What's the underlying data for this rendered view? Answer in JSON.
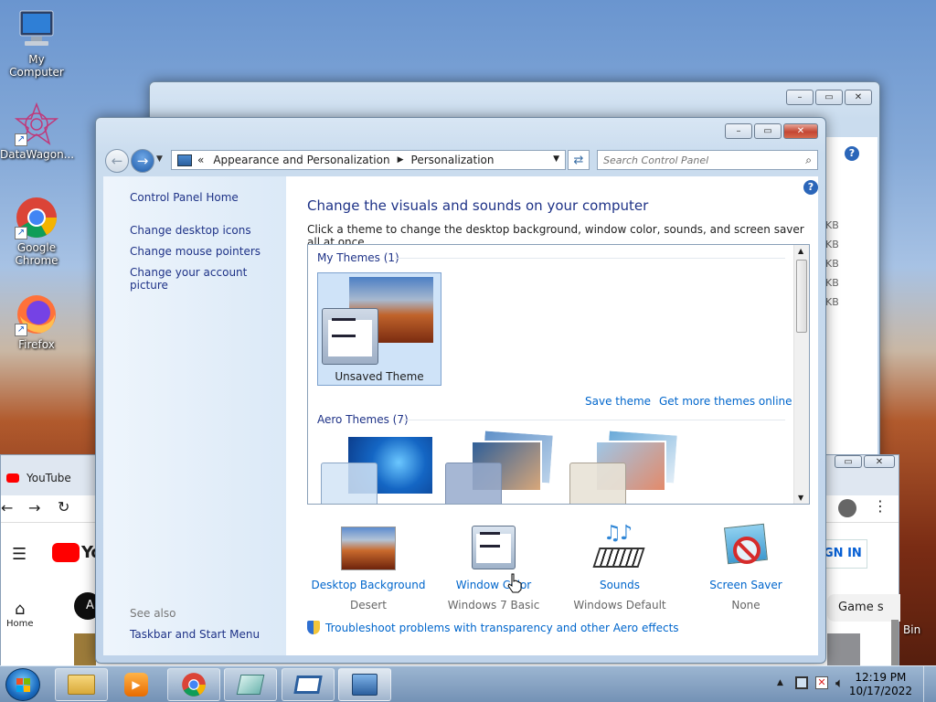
{
  "desktop": {
    "icons": [
      {
        "label": "My Computer",
        "icon": "computer-icon"
      },
      {
        "label": "DataWagon...",
        "icon": "datawagon-icon"
      },
      {
        "label": "Google Chrome",
        "icon": "chrome-icon"
      },
      {
        "label": "Firefox",
        "icon": "firefox-icon"
      }
    ],
    "recycle_bin_label": "Bin"
  },
  "back_explorer": {
    "size_unit_labels": [
      "KB",
      "KB",
      "KB",
      "KB",
      "KB"
    ]
  },
  "browser": {
    "tab_title": "YouTube",
    "nav_home": "Home",
    "sign_in": "GN IN",
    "chip": "A",
    "search_chip": "Game s",
    "logo_text": "Yo"
  },
  "control_panel": {
    "breadcrumb": {
      "prefix": "«",
      "items": [
        "Appearance and Personalization",
        "Personalization"
      ]
    },
    "search_placeholder": "Search Control Panel",
    "left_nav": {
      "home": "Control Panel Home",
      "links": [
        "Change desktop icons",
        "Change mouse pointers",
        "Change your account picture"
      ],
      "see_also_header": "See also",
      "see_also": [
        "Taskbar and Start Menu"
      ]
    },
    "heading": "Change the visuals and sounds on your computer",
    "description": "Click a theme to change the desktop background, window color, sounds, and screen saver all at once.",
    "theme_groups": {
      "my_themes": "My Themes (1)",
      "aero_themes": "Aero Themes (7)"
    },
    "selected_theme": "Unsaved Theme",
    "save_theme": "Save theme",
    "more_themes": "Get more themes online",
    "settings": [
      {
        "label": "Desktop Background",
        "value": "Desert",
        "icon": "desktop-background-icon"
      },
      {
        "label": "Window Color",
        "value": "Windows 7 Basic",
        "icon": "window-color-icon"
      },
      {
        "label": "Sounds",
        "value": "Windows Default",
        "icon": "sounds-icon"
      },
      {
        "label": "Screen Saver",
        "value": "None",
        "icon": "screen-saver-icon"
      }
    ],
    "troubleshoot": "Troubleshoot problems with transparency and other Aero effects"
  },
  "taskbar": {
    "time": "12:19 PM",
    "date": "10/17/2022"
  }
}
